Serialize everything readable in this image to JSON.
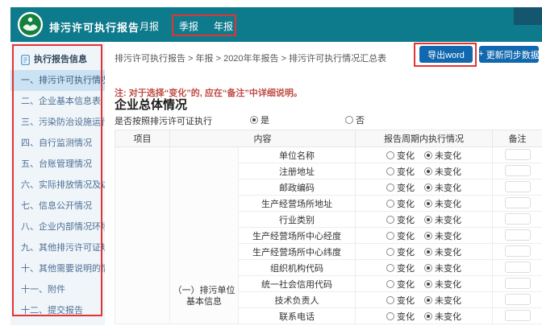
{
  "theme": {
    "header_teal": "#0e7b8d",
    "primary_blue": "#1268ae",
    "highlight_red": "#e23434",
    "selected_item_bg": "#cbe2f3"
  },
  "header": {
    "app_title": "排污许可执行报告",
    "nav": [
      {
        "label": "月报"
      },
      {
        "label": "季报"
      },
      {
        "label": "年报"
      }
    ]
  },
  "sidebar": {
    "items": [
      {
        "label": "执行报告信息"
      },
      {
        "label": "一、排污许可执行情况"
      },
      {
        "label": "二、企业基本信息表"
      },
      {
        "label": "三、污染防治设施运行."
      },
      {
        "label": "四、自行监测情况"
      },
      {
        "label": "五、台账管理情况"
      },
      {
        "label": "六、实际排放情况及达."
      },
      {
        "label": "七、信息公开情况"
      },
      {
        "label": "八、企业内部情况环境."
      },
      {
        "label": "九、其他排污许可证规."
      },
      {
        "label": "十、其他需要说明的情."
      },
      {
        "label": "十一、附件"
      },
      {
        "label": "十二、提交报告"
      }
    ],
    "selected": "一、排污许可执行情况"
  },
  "main": {
    "breadcrumb": "排污许可执行报告 > 年报 > 2020年年报告 > 排污许可执行情况汇总表",
    "export_button": "导出word",
    "sync_plus": "+",
    "sync_button": "更新同步数据",
    "note": "注: 对于选择“变化”的, 应在“备注”中详细说明。",
    "section_title": "企业总体情况",
    "compliance": {
      "label": "是否按照排污许可证执行",
      "yes_label": "是",
      "no_label": "否",
      "selected": "是"
    },
    "table": {
      "headers": [
        "项目",
        "内容",
        "报告周期内执行情况",
        "备注"
      ],
      "group_label_line1": "（一）排污单位",
      "group_label_line2": "基本信息",
      "radio_changed": "变化",
      "radio_unchanged": "未变化",
      "rows": [
        {
          "label": "单位名称",
          "selected": "未变化",
          "remark": ""
        },
        {
          "label": "注册地址",
          "selected": "未变化",
          "remark": ""
        },
        {
          "label": "邮政编码",
          "selected": "未变化",
          "remark": ""
        },
        {
          "label": "生产经营场所地址",
          "selected": "未变化",
          "remark": ""
        },
        {
          "label": "行业类别",
          "selected": "未变化",
          "remark": ""
        },
        {
          "label": "生产经营场所中心经度",
          "selected": "未变化",
          "remark": ""
        },
        {
          "label": "生产经营场所中心纬度",
          "selected": "未变化",
          "remark": ""
        },
        {
          "label": "组织机构代码",
          "selected": "未变化",
          "remark": ""
        },
        {
          "label": "统一社会信用代码",
          "selected": "未变化",
          "remark": ""
        },
        {
          "label": "技术负责人",
          "selected": "未变化",
          "remark": ""
        },
        {
          "label": "联系电话",
          "selected": "未变化",
          "remark": ""
        }
      ]
    }
  }
}
